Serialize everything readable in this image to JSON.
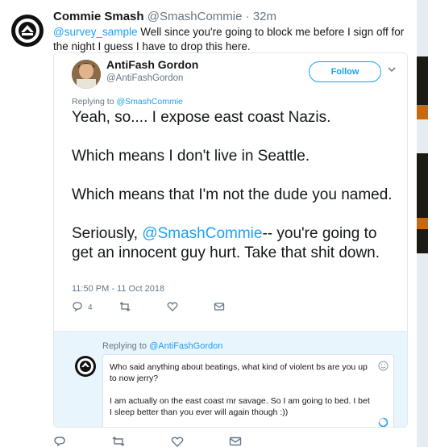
{
  "tweet": {
    "name": "Commie Smash",
    "handle": "@SmashCommie",
    "separator": "·",
    "time": "32m",
    "text_mention": "@survey_sample",
    "text_rest": " Well since you're going to block me before I sign off for the night I guess I have to drop this here."
  },
  "quoted": {
    "name": "AntiFash Gordon",
    "handle": "@AntiFashGordon",
    "follow_label": "Follow",
    "replying_label": "Replying to ",
    "replying_mention": "@SmashCommie",
    "line1": "Yeah, so.... I expose east coast Nazis.",
    "line2": "Which means I don't live in Seattle.",
    "line3": "Which means that I'm not the dude you named.",
    "line4_pre": "Seriously, ",
    "line4_mention": "@SmashCommie",
    "line4_post": "-- you're going to get an innocent guy hurt. Take that shit down.",
    "date": "11:50 PM - 11 Oct 2018",
    "reply_count": "4"
  },
  "reply": {
    "replying_label": "Replying to ",
    "replying_mention": "@AntiFashGordon",
    "draft": "Who said anything about beatings, what kind of violent bs are you up to now jerry?\n\nI am actually on the east coast mr savage. So I am going to bed. I bet I sleep better than you ever will again though :))"
  },
  "colors": {
    "accent": "#1da1f2",
    "secondary_text": "#657786",
    "reply_background": "#e8f5fd"
  },
  "icons": [
    "reply-icon",
    "retweet-icon",
    "like-icon",
    "message-icon",
    "chevron-down-icon",
    "emoji-icon",
    "progress-icon"
  ]
}
